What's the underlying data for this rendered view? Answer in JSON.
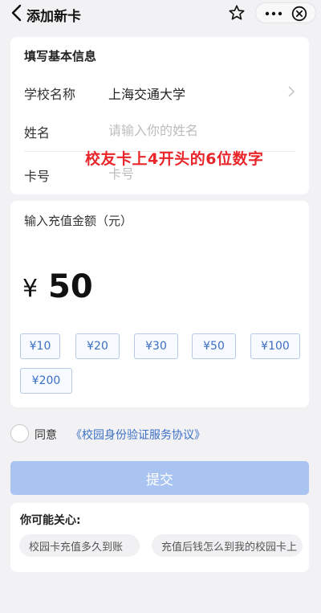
{
  "navbar": {
    "title": "添加新卡",
    "icons": [
      "back-arrow-icon",
      "star-icon",
      "more-icon",
      "close-icon"
    ]
  },
  "info": {
    "section_title": "填写基本信息",
    "school_label": "学校名称",
    "school_value": "上海交通大学",
    "name_label": "姓名",
    "name_placeholder": "请输入你的姓名",
    "card_label": "卡号",
    "card_placeholder": "卡号",
    "annotation": "校友卡上4开头的6位数字"
  },
  "amount": {
    "title": "输入充值金额（元）",
    "currency": "¥",
    "value": "50",
    "options": [
      "¥10",
      "¥20",
      "¥30",
      "¥50",
      "¥100",
      "¥200"
    ]
  },
  "agreement": {
    "prefix": "同意",
    "link": "《校园身份验证服务协议》"
  },
  "submit_label": "提交",
  "faq": {
    "title": "你可能关心:",
    "items": [
      "校园卡充值多久到账",
      "充值后钱怎么到我的校园卡上"
    ]
  },
  "colors": {
    "accent": "#3b6fc4",
    "submit_disabled": "#a9c4f1",
    "annotation": "#e8262b"
  }
}
